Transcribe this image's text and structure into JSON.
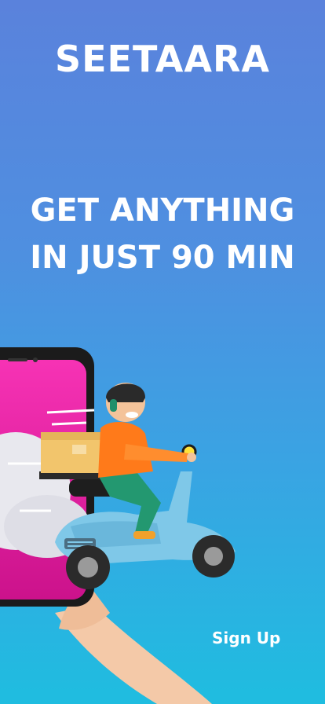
{
  "app": {
    "brand": "SEETAARA",
    "tagline_line1": "GET ANYTHING",
    "tagline_line2": "IN JUST 90 MIN"
  },
  "actions": {
    "signup_label": "Sign Up"
  },
  "colors": {
    "bg_top": "#5a82dc",
    "bg_bottom": "#1fbde0",
    "phone_screen": "#e2179a",
    "scooter": "#7fc8e8",
    "shirt": "#ff7a1a"
  },
  "illustration": {
    "icon": "delivery-scooter-illustration"
  }
}
